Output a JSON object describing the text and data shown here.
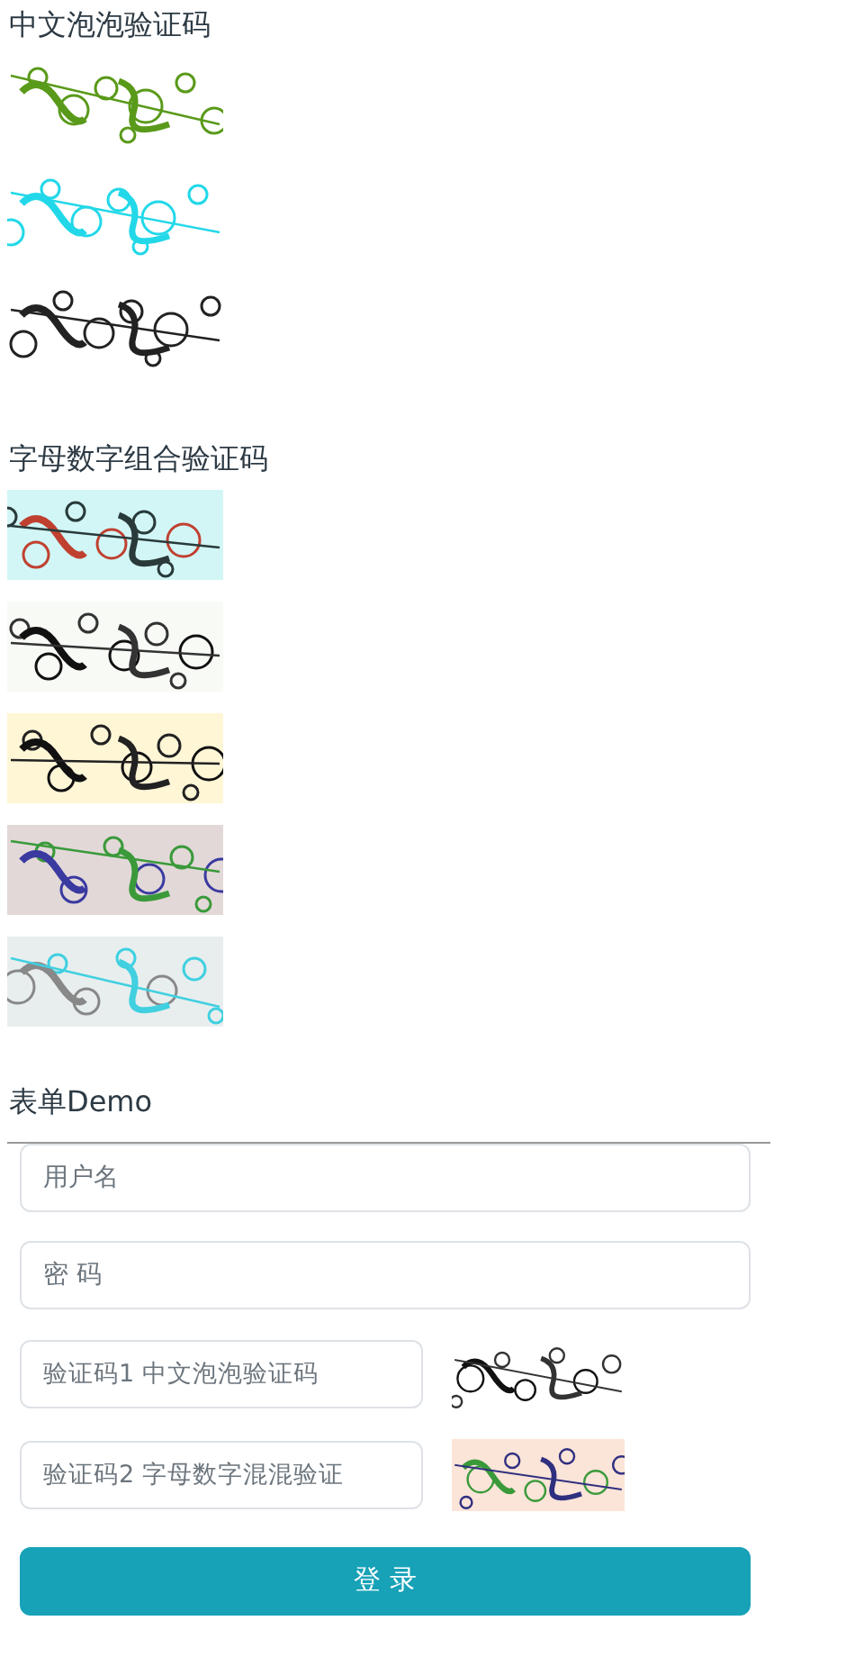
{
  "sections": [
    {
      "title": "中文泡泡验证码"
    },
    {
      "title": "字母数字组合验证码"
    }
  ],
  "form": {
    "title": "表单Demo",
    "fields": [
      {
        "kind": "text",
        "placeholder": "用户名"
      },
      {
        "kind": "password",
        "placeholder": "密 码"
      },
      {
        "kind": "captcha",
        "placeholder": "验证码1 中文泡泡验证码"
      },
      {
        "kind": "captcha",
        "placeholder": "验证码2 字母数字混混验证"
      }
    ],
    "submit": "登 录"
  }
}
